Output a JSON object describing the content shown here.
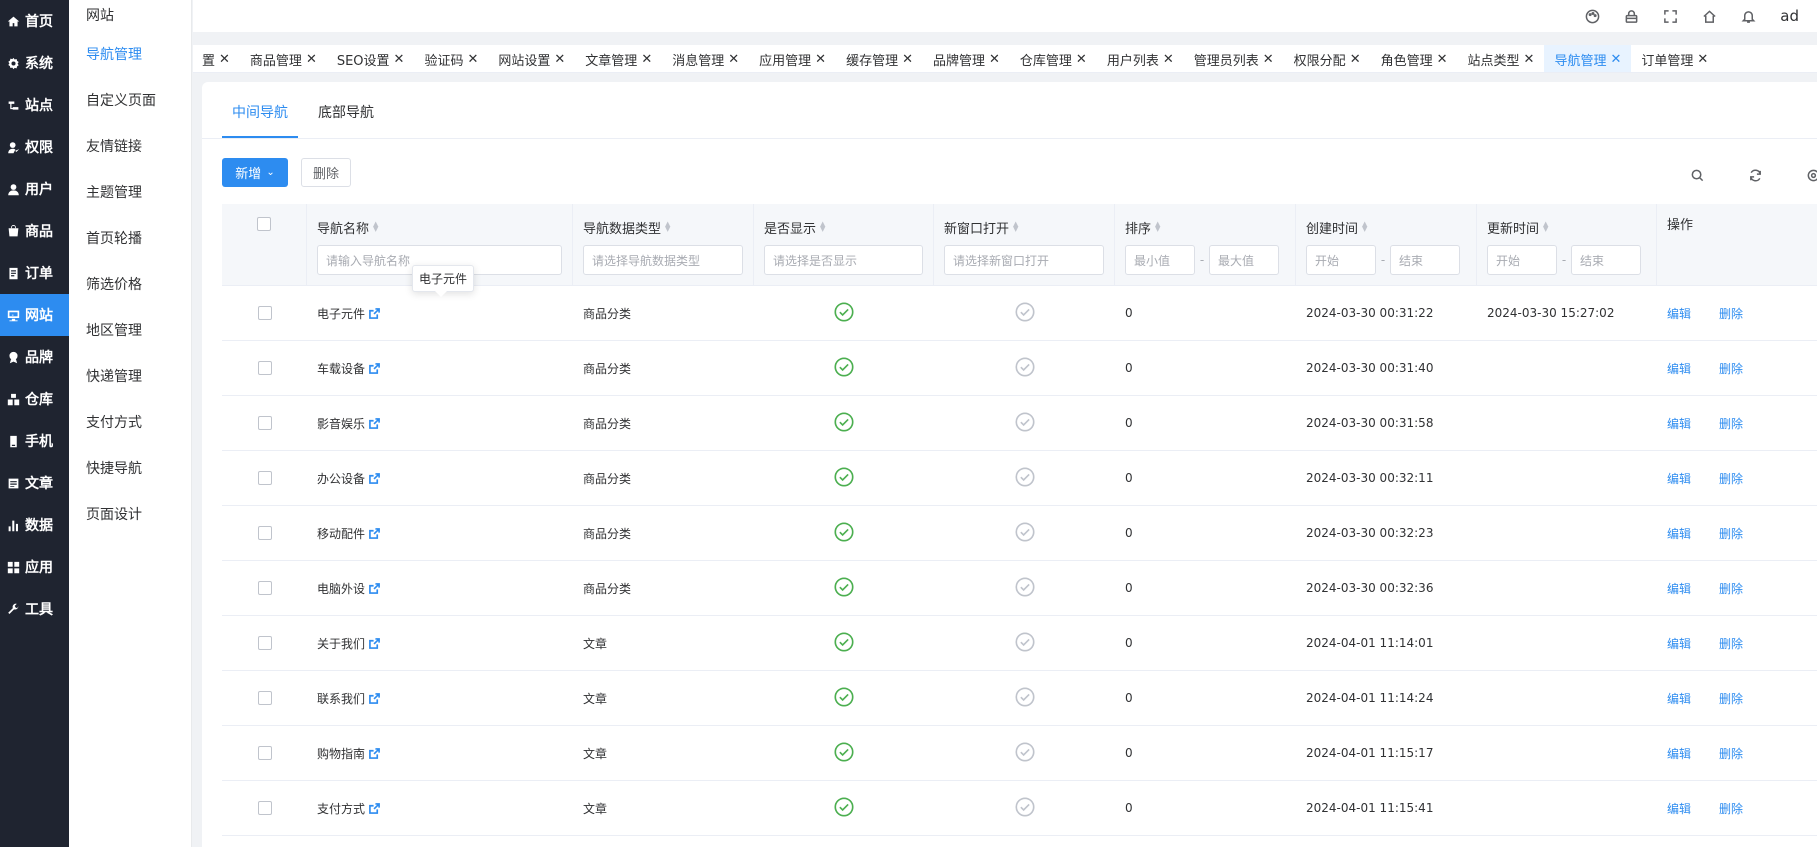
{
  "sidebar": {
    "items": [
      {
        "label": "首页",
        "icon": "home-icon"
      },
      {
        "label": "系统",
        "icon": "gear-icon"
      },
      {
        "label": "站点",
        "icon": "sites-icon"
      },
      {
        "label": "权限",
        "icon": "permission-icon"
      },
      {
        "label": "用户",
        "icon": "user-icon"
      },
      {
        "label": "商品",
        "icon": "goods-icon"
      },
      {
        "label": "订单",
        "icon": "order-icon"
      },
      {
        "label": "网站",
        "icon": "website-icon"
      },
      {
        "label": "品牌",
        "icon": "brand-icon"
      },
      {
        "label": "仓库",
        "icon": "warehouse-icon"
      },
      {
        "label": "手机",
        "icon": "mobile-icon"
      },
      {
        "label": "文章",
        "icon": "article-icon"
      },
      {
        "label": "数据",
        "icon": "chart-icon"
      },
      {
        "label": "应用",
        "icon": "apps-icon"
      },
      {
        "label": "工具",
        "icon": "wrench-icon"
      }
    ],
    "active_index": 7
  },
  "subnav": {
    "title": "网站",
    "items": [
      "导航管理",
      "自定义页面",
      "友情链接",
      "主题管理",
      "首页轮播",
      "筛选价格",
      "地区管理",
      "快递管理",
      "支付方式",
      "快捷导航",
      "页面设计"
    ],
    "active_index": 0
  },
  "header": {
    "user": "ad"
  },
  "tabs": {
    "items": [
      "置",
      "商品管理",
      "SEO设置",
      "验证码",
      "网站设置",
      "文章管理",
      "消息管理",
      "应用管理",
      "缓存管理",
      "品牌管理",
      "仓库管理",
      "用户列表",
      "管理员列表",
      "权限分配",
      "角色管理",
      "站点类型",
      "导航管理",
      "订单管理"
    ],
    "active_index": 16,
    "close_glyph": "✕"
  },
  "subtabs": {
    "items": [
      "中间导航",
      "底部导航"
    ],
    "active_index": 0
  },
  "toolbar": {
    "new_label": "新增",
    "delete_label": "删除"
  },
  "table": {
    "columns": {
      "name": "导航名称",
      "type": "导航数据类型",
      "visible": "是否显示",
      "new_window": "新窗口打开",
      "sort": "排序",
      "created": "创建时间",
      "updated": "更新时间",
      "actions": "操作"
    },
    "filters": {
      "name_placeholder": "请输入导航名称",
      "type_placeholder": "请选择导航数据类型",
      "visible_placeholder": "请选择是否显示",
      "new_window_placeholder": "请选择新窗口打开",
      "sort_min": "最小值",
      "sort_max": "最大值",
      "created_start": "开始",
      "created_end": "结束",
      "updated_start": "开始",
      "updated_end": "结束",
      "range_sep": "-"
    },
    "tooltip": "电子元件",
    "action_edit": "编辑",
    "action_delete": "删除",
    "rows": [
      {
        "name": "电子元件",
        "type": "商品分类",
        "visible": true,
        "new_window": false,
        "sort": "0",
        "created": "2024-03-30 00:31:22",
        "updated": "2024-03-30 15:27:02"
      },
      {
        "name": "车载设备",
        "type": "商品分类",
        "visible": true,
        "new_window": false,
        "sort": "0",
        "created": "2024-03-30 00:31:40",
        "updated": ""
      },
      {
        "name": "影音娱乐",
        "type": "商品分类",
        "visible": true,
        "new_window": false,
        "sort": "0",
        "created": "2024-03-30 00:31:58",
        "updated": ""
      },
      {
        "name": "办公设备",
        "type": "商品分类",
        "visible": true,
        "new_window": false,
        "sort": "0",
        "created": "2024-03-30 00:32:11",
        "updated": ""
      },
      {
        "name": "移动配件",
        "type": "商品分类",
        "visible": true,
        "new_window": false,
        "sort": "0",
        "created": "2024-03-30 00:32:23",
        "updated": ""
      },
      {
        "name": "电脑外设",
        "type": "商品分类",
        "visible": true,
        "new_window": false,
        "sort": "0",
        "created": "2024-03-30 00:32:36",
        "updated": ""
      },
      {
        "name": "关于我们",
        "type": "文章",
        "visible": true,
        "new_window": false,
        "sort": "0",
        "created": "2024-04-01 11:14:01",
        "updated": ""
      },
      {
        "name": "联系我们",
        "type": "文章",
        "visible": true,
        "new_window": false,
        "sort": "0",
        "created": "2024-04-01 11:14:24",
        "updated": ""
      },
      {
        "name": "购物指南",
        "type": "文章",
        "visible": true,
        "new_window": false,
        "sort": "0",
        "created": "2024-04-01 11:15:17",
        "updated": ""
      },
      {
        "name": "支付方式",
        "type": "文章",
        "visible": true,
        "new_window": false,
        "sort": "0",
        "created": "2024-04-01 11:15:41",
        "updated": ""
      }
    ]
  },
  "colors": {
    "accent": "#2d8cf0",
    "sidebar_bg": "#1f2430",
    "ok_green": "#4caf50",
    "muted_gray": "#c0c4cc"
  }
}
